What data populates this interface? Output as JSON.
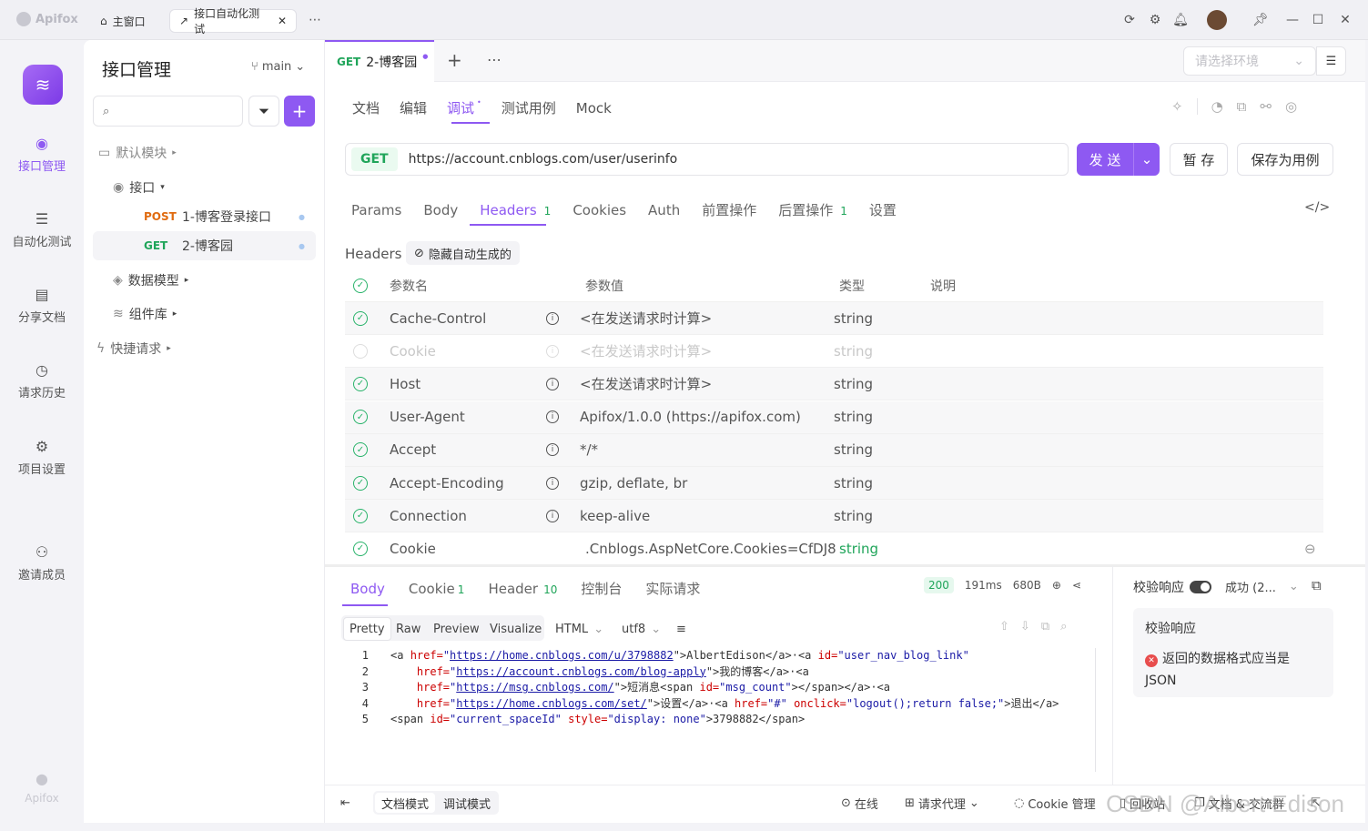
{
  "titlebar": {
    "logo": "Apifox",
    "tabs": [
      {
        "label": "主窗口"
      },
      {
        "label": "接口自动化测试"
      }
    ]
  },
  "rail": {
    "items": [
      {
        "label": "接口管理"
      },
      {
        "label": "自动化测试"
      },
      {
        "label": "分享文档"
      },
      {
        "label": "请求历史"
      },
      {
        "label": "项目设置"
      },
      {
        "label": "邀请成员"
      }
    ],
    "footer_logo": "Apifox"
  },
  "sidebar": {
    "title": "接口管理",
    "branch": "main",
    "search_placeholder": "",
    "tree": {
      "default_module": "默认模块",
      "api_folder": "接口",
      "apis": [
        {
          "method": "POST",
          "name": "1-博客登录接口"
        },
        {
          "method": "GET",
          "name": "2-博客园"
        }
      ],
      "data_model": "数据模型",
      "components": "组件库",
      "quick_request": "快捷请求"
    }
  },
  "main": {
    "tab": {
      "method": "GET",
      "name": "2-博客园"
    },
    "env_placeholder": "请选择环境",
    "subtabs": [
      "文档",
      "编辑",
      "调试",
      "测试用例",
      "Mock"
    ],
    "request": {
      "method": "GET",
      "url": "https://account.cnblogs.com/user/userinfo",
      "send": "发 送",
      "save": "暂 存",
      "save_case": "保存为用例"
    },
    "param_tabs": {
      "params": "Params",
      "body": "Body",
      "headers": "Headers",
      "headers_count": "1",
      "cookies": "Cookies",
      "auth": "Auth",
      "pre": "前置操作",
      "post": "后置操作",
      "post_count": "1",
      "settings": "设置"
    },
    "headers_label": "Headers",
    "hide_auto": "隐藏自动生成的",
    "columns": {
      "name": "参数名",
      "value": "参数值",
      "type": "类型",
      "desc": "说明"
    },
    "rows": [
      {
        "name": "Cache-Control",
        "value": "<在发送请求时计算>",
        "type": "string"
      },
      {
        "name": "Cookie",
        "value": "<在发送请求时计算>",
        "type": "string"
      },
      {
        "name": "Host",
        "value": "<在发送请求时计算>",
        "type": "string"
      },
      {
        "name": "User-Agent",
        "value": "Apifox/1.0.0 (https://apifox.com)",
        "type": "string"
      },
      {
        "name": "Accept",
        "value": "*/*",
        "type": "string"
      },
      {
        "name": "Accept-Encoding",
        "value": "gzip, deflate, br",
        "type": "string"
      },
      {
        "name": "Connection",
        "value": "keep-alive",
        "type": "string"
      },
      {
        "name": "Cookie",
        "value": ".Cnblogs.AspNetCore.Cookies=CfDJ8",
        "type": "string"
      }
    ]
  },
  "response": {
    "tabs": {
      "body": "Body",
      "cookie": "Cookie",
      "cookie_count": "1",
      "header": "Header",
      "header_count": "10",
      "console": "控制台",
      "actual": "实际请求"
    },
    "status": "200",
    "time": "191ms",
    "size": "680B",
    "view_tabs": [
      "Pretty",
      "Raw",
      "Preview",
      "Visualize"
    ],
    "format": "HTML",
    "encoding": "utf8",
    "line_numbers": [
      "1",
      "2",
      "3",
      "4",
      "5"
    ],
    "code": {
      "l1a": "<a ",
      "l1b": "href=",
      "l1c": "\"",
      "l1d": "https://home.cnblogs.com/u/3798882",
      "l1e": "\">AlbertEdison</a>·<a ",
      "l1f": "id=",
      "l1g": "\"user_nav_blog_link\"",
      "l2a": "    href=",
      "l2b": "\"",
      "l2c": "https://account.cnblogs.com/blog-apply",
      "l2d": "\">我的博客</a>·<a",
      "l3a": "    href=",
      "l3b": "\"",
      "l3c": "https://msg.cnblogs.com/",
      "l3d": "\">短消息<span ",
      "l3e": "id=",
      "l3f": "\"msg_count\"",
      "l3g": "></span></a>·<a",
      "l4a": "    href=",
      "l4b": "\"",
      "l4c": "https://home.cnblogs.com/set/",
      "l4d": "\">设置</a>·<a ",
      "l4e": "href=",
      "l4f": "\"#\"",
      "l4g": " onclick=",
      "l4h": "\"logout();return false;\"",
      "l4i": ">退出</a>",
      "l5a": "<span ",
      "l5b": "id=",
      "l5c": "\"current_spaceId\"",
      "l5d": " style=",
      "l5e": "\"display: none\"",
      "l5f": ">3798882</span>"
    },
    "validate": {
      "label": "校验响应",
      "result": "成功 (2...",
      "panel_title": "校验响应",
      "message": "返回的数据格式应当是 JSON"
    }
  },
  "bottombar": {
    "doc_mode": "文档模式",
    "debug_mode": "调试模式",
    "online": "在线",
    "proxy": "请求代理",
    "cookie_mgr": "Cookie 管理",
    "recycle": "回收站",
    "docs": "文档 & 交流群"
  },
  "watermark": "CSDN @Albert Edison",
  "colors": {
    "accent": "#8e59f2",
    "get": "#20a55a",
    "post": "#e06b10",
    "ok": "#29b36a",
    "error": "#e84d4d"
  }
}
